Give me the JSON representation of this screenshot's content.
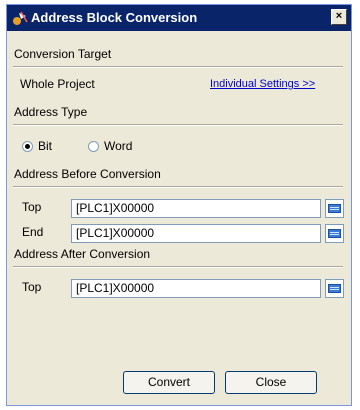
{
  "window": {
    "title": "Address Block Conversion",
    "close_label": "×"
  },
  "conversion_target": {
    "heading": "Conversion Target",
    "whole_project": "Whole Project",
    "individual_settings": "Individual Settings >>"
  },
  "address_type": {
    "heading": "Address Type",
    "options": [
      {
        "label": "Bit",
        "selected": true
      },
      {
        "label": "Word",
        "selected": false
      }
    ]
  },
  "before": {
    "heading": "Address Before Conversion",
    "top_label": "Top",
    "top_value": "[PLC1]X00000",
    "end_label": "End",
    "end_value": "[PLC1]X00000"
  },
  "after": {
    "heading": "Address After Conversion",
    "top_label": "Top",
    "top_value": "[PLC1]X00000"
  },
  "buttons": {
    "convert": "Convert",
    "close": "Close"
  }
}
